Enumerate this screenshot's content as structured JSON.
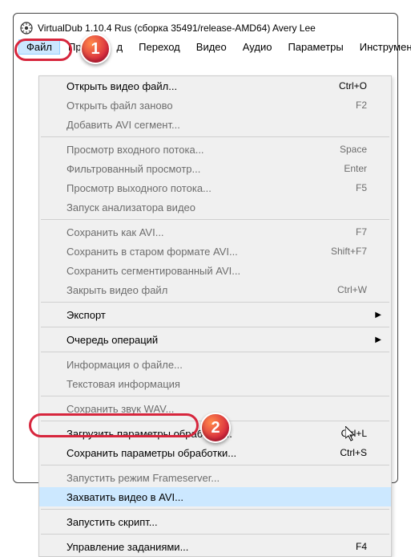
{
  "title": "VirtualDub 1.10.4 Rus (сборка 35491/release-AMD64) Avery Lee",
  "menubar": {
    "file": "Файл",
    "edit_partial": "Пр",
    "edit_suffix": "д",
    "goto": "Переход",
    "video": "Видео",
    "audio": "Аудио",
    "params": "Параметры",
    "tools": "Инструменты"
  },
  "badges": {
    "one": "1",
    "two": "2"
  },
  "menu": {
    "open": "Открыть видео файл...",
    "open_sc": "Ctrl+O",
    "reopen": "Открыть файл заново",
    "reopen_sc": "F2",
    "addseg": "Добавить AVI сегмент...",
    "previn": "Просмотр входного потока...",
    "previn_sc": "Space",
    "filtered": "Фильтрованный просмотр...",
    "filtered_sc": "Enter",
    "prevout": "Просмотр выходного потока...",
    "prevout_sc": "F5",
    "analyzer": "Запуск анализатора видео",
    "saveavi": "Сохранить как AVI...",
    "saveavi_sc": "F7",
    "saveold": "Сохранить в старом формате AVI...",
    "saveold_sc": "Shift+F7",
    "saveseg": "Сохранить сегментированный AVI...",
    "close": "Закрыть видео файл",
    "close_sc": "Ctrl+W",
    "export": "Экспорт",
    "queue": "Очередь операций",
    "info": "Информация о файле...",
    "textinfo": "Текстовая информация",
    "savewav": "Сохранить звук WAV...",
    "loadproc": "Загрузить параметры обработки...",
    "loadproc_sc": "Ctrl+L",
    "saveproc": "Сохранить параметры обработки...",
    "saveproc_sc": "Ctrl+S",
    "frameserver": "Запустить режим Frameserver...",
    "capture": "Захватить видео в AVI...",
    "script": "Запустить скрипт...",
    "jobs": "Управление заданиями...",
    "jobs_sc": "F4"
  }
}
